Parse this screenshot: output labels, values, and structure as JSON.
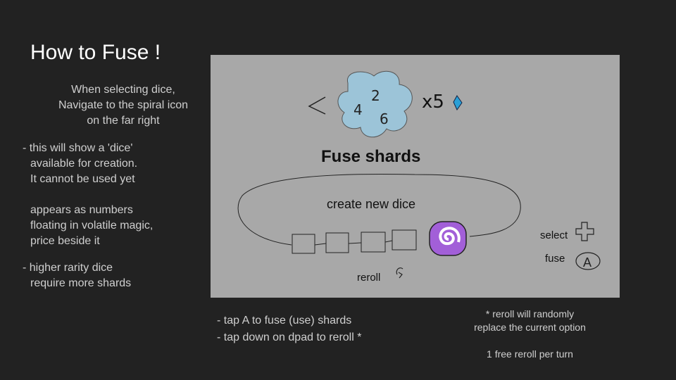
{
  "title": "How to Fuse !",
  "intro": [
    "When selecting dice,",
    "Navigate to the spiral icon",
    "on the far right"
  ],
  "bullets": [
    "- this will show a 'dice'",
    "  available for creation.",
    "  It cannot be used yet",
    "  appears as numbers",
    "  floating in volatile magic,",
    "  price beside it",
    "- higher rarity dice",
    "  require more shards"
  ],
  "mockup": {
    "dice_numbers": [
      "2",
      "4",
      "6"
    ],
    "price": "x5",
    "fuse_title": "Fuse shards",
    "create_label": "create new dice",
    "reroll_label": "reroll",
    "select_label": "select",
    "fuse_label": "fuse",
    "fuse_button": "A",
    "colors": {
      "cloud": "#9cc4d8",
      "shard": "#2a9fd6",
      "spiral": "#a25fd8"
    }
  },
  "instructions": [
    "- tap A to fuse (use) shards",
    "- tap down on dpad to reroll *"
  ],
  "note": [
    "* reroll will randomly",
    "replace the current option",
    "1 free reroll per turn"
  ]
}
